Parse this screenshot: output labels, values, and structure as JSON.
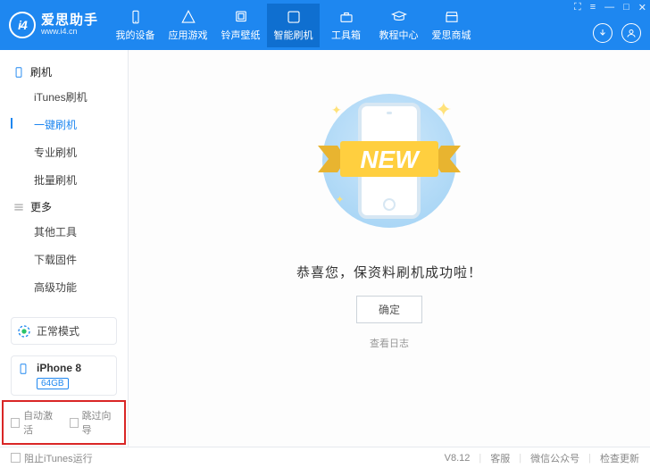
{
  "brand": {
    "name": "爱思助手",
    "url": "www.i4.cn",
    "logo_text": "i4"
  },
  "nav": {
    "items": [
      {
        "id": "device",
        "label": "我的设备"
      },
      {
        "id": "apps",
        "label": "应用游戏"
      },
      {
        "id": "ringtones",
        "label": "铃声壁纸"
      },
      {
        "id": "flash",
        "label": "智能刷机"
      },
      {
        "id": "toolbox",
        "label": "工具箱"
      },
      {
        "id": "tutorials",
        "label": "教程中心"
      },
      {
        "id": "store",
        "label": "爱思商城"
      }
    ],
    "active": "flash"
  },
  "sidebar": {
    "sections": [
      {
        "title": "刷机",
        "items": [
          {
            "id": "itunes",
            "label": "iTunes刷机"
          },
          {
            "id": "oneclick",
            "label": "一键刷机",
            "active": true
          },
          {
            "id": "pro",
            "label": "专业刷机"
          },
          {
            "id": "batch",
            "label": "批量刷机"
          }
        ]
      },
      {
        "title": "更多",
        "items": [
          {
            "id": "other",
            "label": "其他工具"
          },
          {
            "id": "firmware",
            "label": "下载固件"
          },
          {
            "id": "advanced",
            "label": "高级功能"
          }
        ]
      }
    ],
    "status": "正常模式",
    "device": {
      "name": "iPhone 8",
      "storage": "64GB"
    },
    "checks": {
      "auto_activate": "自动激活",
      "skip_guide": "跳过向导"
    }
  },
  "main": {
    "ribbon": "NEW",
    "congrats": "恭喜您，保资料刷机成功啦！",
    "ok": "确定",
    "view_log": "查看日志"
  },
  "footer": {
    "block_itunes": "阻止iTunes运行",
    "version": "V8.12",
    "support": "客服",
    "wechat": "微信公众号",
    "update": "检查更新"
  }
}
